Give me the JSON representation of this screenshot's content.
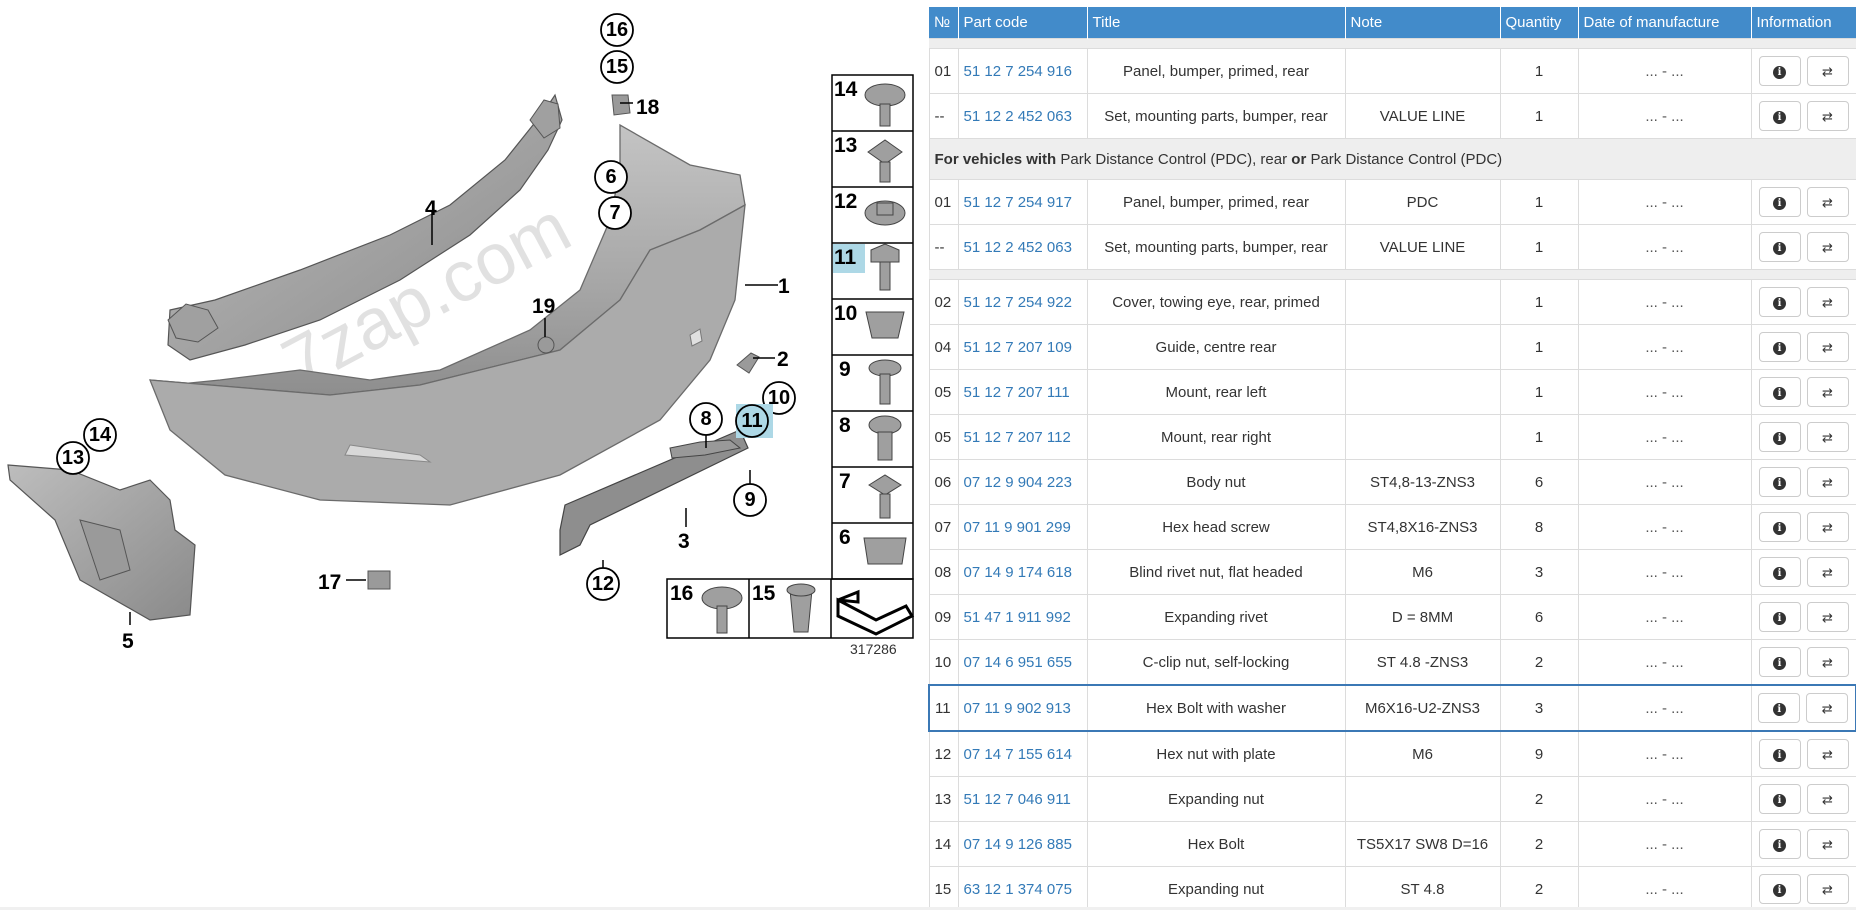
{
  "diagram": {
    "image_number": "317286",
    "watermark": "7zap.com",
    "callouts": [
      "1",
      "2",
      "3",
      "4",
      "5",
      "6",
      "7",
      "8",
      "9",
      "10",
      "11",
      "12",
      "13",
      "14",
      "15",
      "16",
      "17",
      "18",
      "19"
    ],
    "legend_labels": [
      "14",
      "13",
      "12",
      "11",
      "10",
      "9",
      "8",
      "7",
      "6",
      "16",
      "15"
    ],
    "highlighted_callout": "11"
  },
  "table": {
    "headers": {
      "no": "№",
      "code": "Part code",
      "title": "Title",
      "note": "Note",
      "qty": "Quantity",
      "date": "Date of manufacture",
      "info": "Information"
    },
    "group": {
      "prefix": "For vehicles with",
      "opt1": "Park Distance Control (PDC), rear",
      "joiner": "or",
      "opt2": "Park Distance Control (PDC)"
    },
    "rows_a": [
      {
        "no": "01",
        "code": "51 12 7 254 916",
        "title": "Panel, bumper, primed, rear",
        "note": "",
        "qty": "1",
        "date": "... - ..."
      },
      {
        "no": "--",
        "code": "51 12 2 452 063",
        "title": "Set, mounting parts, bumper, rear",
        "note": "VALUE LINE",
        "qty": "1",
        "date": "... - ..."
      }
    ],
    "rows_b": [
      {
        "no": "01",
        "code": "51 12 7 254 917",
        "title": "Panel, bumper, primed, rear",
        "note": "PDC",
        "qty": "1",
        "date": "... - ..."
      },
      {
        "no": "--",
        "code": "51 12 2 452 063",
        "title": "Set, mounting parts, bumper, rear",
        "note": "VALUE LINE",
        "qty": "1",
        "date": "... - ..."
      }
    ],
    "rows_c": [
      {
        "no": "02",
        "code": "51 12 7 254 922",
        "title": "Cover, towing eye, rear, primed",
        "note": "",
        "qty": "1",
        "date": "... - ..."
      },
      {
        "no": "04",
        "code": "51 12 7 207 109",
        "title": "Guide, centre rear",
        "note": "",
        "qty": "1",
        "date": "... - ..."
      },
      {
        "no": "05",
        "code": "51 12 7 207 111",
        "title": "Mount, rear left",
        "note": "",
        "qty": "1",
        "date": "... - ..."
      },
      {
        "no": "05",
        "code": "51 12 7 207 112",
        "title": "Mount, rear right",
        "note": "",
        "qty": "1",
        "date": "... - ..."
      },
      {
        "no": "06",
        "code": "07 12 9 904 223",
        "title": "Body nut",
        "note": "ST4,8-13-ZNS3",
        "qty": "6",
        "date": "... - ..."
      },
      {
        "no": "07",
        "code": "07 11 9 901 299",
        "title": "Hex head screw",
        "note": "ST4,8X16-ZNS3",
        "qty": "8",
        "date": "... - ..."
      },
      {
        "no": "08",
        "code": "07 14 9 174 618",
        "title": "Blind rivet nut, flat headed",
        "note": "M6",
        "qty": "3",
        "date": "... - ..."
      },
      {
        "no": "09",
        "code": "51 47 1 911 992",
        "title": "Expanding rivet",
        "note": "D = 8MM",
        "qty": "6",
        "date": "... - ..."
      },
      {
        "no": "10",
        "code": "07 14 6 951 655",
        "title": "C-clip nut, self-locking",
        "note": "ST 4.8 -ZNS3",
        "qty": "2",
        "date": "... - ..."
      },
      {
        "no": "11",
        "code": "07 11 9 902 913",
        "title": "Hex Bolt with washer",
        "note": "M6X16-U2-ZNS3",
        "qty": "3",
        "date": "... - ...",
        "selected": true
      },
      {
        "no": "12",
        "code": "07 14 7 155 614",
        "title": "Hex nut with plate",
        "note": "M6",
        "qty": "9",
        "date": "... - ..."
      },
      {
        "no": "13",
        "code": "51 12 7 046 911",
        "title": "Expanding nut",
        "note": "",
        "qty": "2",
        "date": "... - ..."
      },
      {
        "no": "14",
        "code": "07 14 9 126 885",
        "title": "Hex Bolt",
        "note": "TS5X17 SW8 D=16",
        "qty": "2",
        "date": "... - ..."
      },
      {
        "no": "15",
        "code": "63 12 1 374 075",
        "title": "Expanding nut",
        "note": "ST 4.8",
        "qty": "2",
        "date": "... - ..."
      }
    ],
    "icons": {
      "info": "info-icon",
      "compare": "swap-arrows-icon"
    },
    "colors": {
      "header_bg": "#428bca",
      "link": "#337ab7",
      "group_bg": "#eeeeee",
      "highlight": "#add8e6"
    }
  }
}
